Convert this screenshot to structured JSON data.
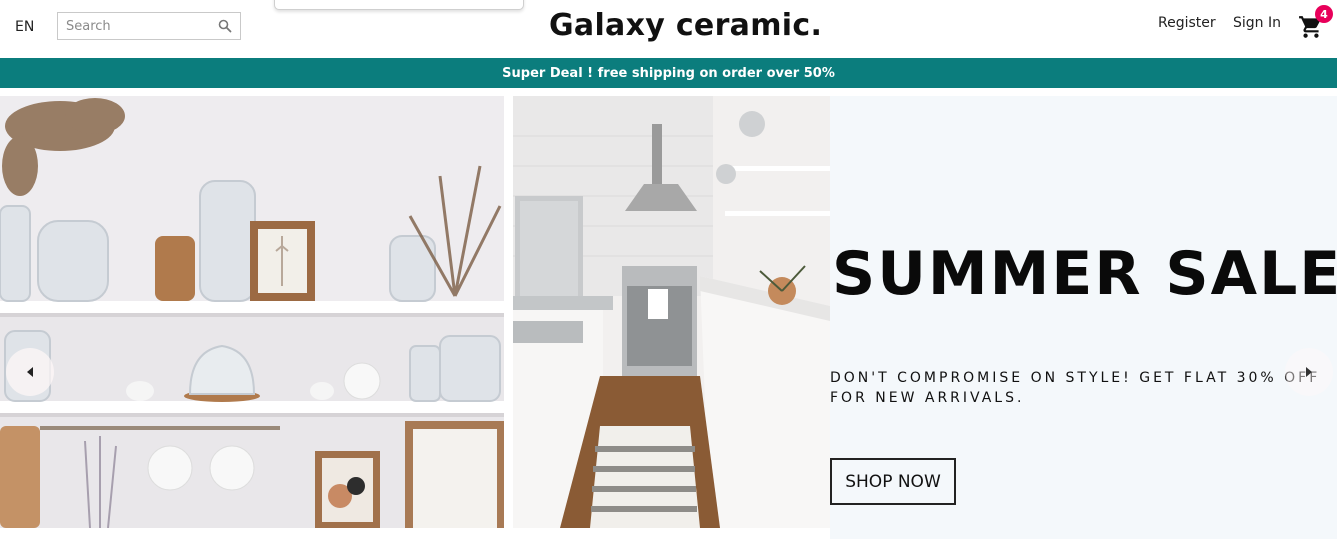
{
  "header": {
    "language": "EN",
    "search": {
      "placeholder": "Search",
      "value": ""
    },
    "logo": "Galaxy ceramic.",
    "menu": {
      "register": "Register",
      "sign_in": "Sign In"
    },
    "cart": {
      "count": "4",
      "icon": "cart-icon"
    }
  },
  "announcement": {
    "text": "Super Deal ! free shipping on order over 50%"
  },
  "slide": {
    "title": "SUMMER SALE",
    "description": "DON'T COMPROMISE ON STYLE! GET FLAT 30% OFF FOR NEW ARRIVALS.",
    "button_label": "SHOP NOW",
    "background": "#f4f8fb"
  },
  "colors": {
    "accent": "#0b7d7d",
    "badge": "#e8005a"
  }
}
